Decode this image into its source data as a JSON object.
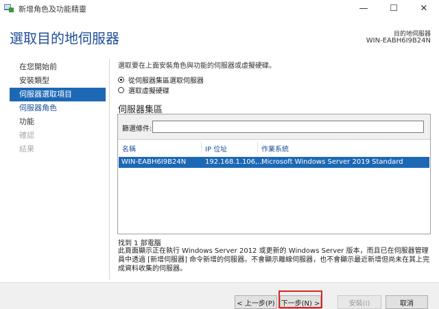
{
  "window": {
    "title": "新增角色及功能精靈",
    "minimize_glyph": "—",
    "maximize_glyph": "☐",
    "close_glyph": "✕"
  },
  "header": {
    "page_title": "選取目的地伺服器",
    "dest_label": "目的地伺服器",
    "dest_server": "WIN-EABH6I9B24N"
  },
  "sidebar": {
    "items": [
      {
        "label": "在您開始前",
        "state": "normal"
      },
      {
        "label": "安裝類型",
        "state": "normal"
      },
      {
        "label": "伺服器選取項目",
        "state": "active"
      },
      {
        "label": "伺服器角色",
        "state": "link"
      },
      {
        "label": "功能",
        "state": "normal"
      },
      {
        "label": "確認",
        "state": "disabled"
      },
      {
        "label": "結果",
        "state": "disabled"
      }
    ]
  },
  "main": {
    "instruction": "選取要在上面安裝角色與功能的伺服器或虛擬硬碟。",
    "radio_pool": "從伺服器集區選取伺服器",
    "radio_vhd": "選取虛擬硬碟",
    "pool_title": "伺服器集區",
    "filter_label": "篩選條件:",
    "filter_value": "",
    "columns": [
      "名稱",
      "IP 位址",
      "作業系統"
    ],
    "rows": [
      [
        "WIN-EABH6I9B24N",
        "192.168.1.106,...",
        "Microsoft Windows Server 2019 Standard"
      ]
    ],
    "found": "找到 1 部電腦",
    "note": "此頁面顯示正在執行 Windows Server 2012 或更新的 Windows Server 版本，而且已在伺服器管理員中透過 [新增伺服器] 命令新增的伺服器。不會顯示離線伺服器，也不會顯示最近新增但尚未在其上完成資料收集的伺服器。"
  },
  "footer": {
    "prev": "< 上一步(P)",
    "next": "下一步(N) >",
    "install": "安裝(I)",
    "cancel": "取消"
  },
  "colors": {
    "accent": "#1c68b5",
    "title_blue": "#1f4e99",
    "focus_red": "#d9261c"
  }
}
